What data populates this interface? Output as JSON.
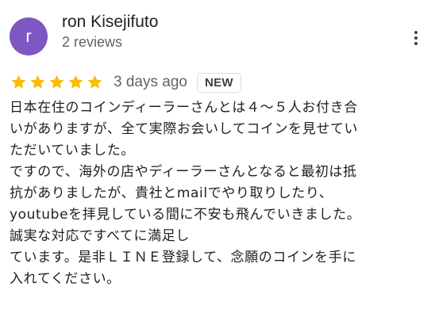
{
  "author": {
    "initial": "r",
    "name": "ron Kisejifuto",
    "meta": "2 reviews",
    "avatar_color": "#7e57c2"
  },
  "menu": {
    "icon": "more-vert-icon"
  },
  "rating": {
    "stars": 5,
    "max_stars": 5,
    "star_color": "#fbbc04",
    "date": "3 days ago",
    "badge": "NEW"
  },
  "review": {
    "lines": [
      "日本在住のコインディーラーさんとは４～５人お付き合",
      "いがありますが、全て実際お会いしてコインを見せてい",
      "ただいていました。",
      "ですので、海外の店やディーラーさんとなると最初は抵",
      "抗がありましたが、貴社とmailでやり取りしたり、",
      "youtubeを拝見している間に不安も飛んでいきました。",
      "誠実な対応ですべてに満足し",
      "ています。是非ＬＩＮＥ登録して、念願のコインを手に",
      "入れてください。"
    ]
  }
}
